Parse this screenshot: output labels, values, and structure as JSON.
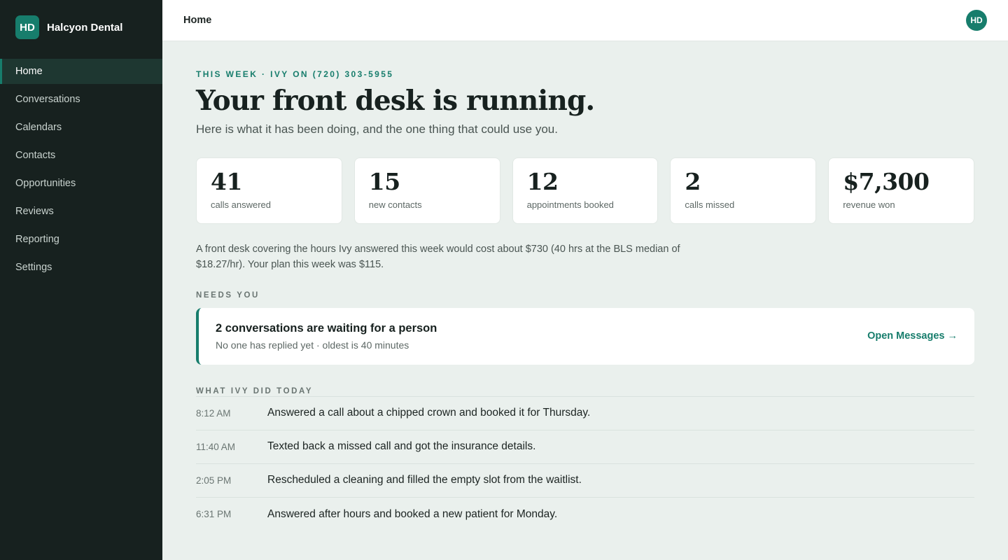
{
  "brand": {
    "initials": "HD",
    "name": "Halcyon Dental"
  },
  "nav": [
    {
      "label": "Home",
      "active": true
    },
    {
      "label": "Conversations"
    },
    {
      "label": "Calendars"
    },
    {
      "label": "Contacts"
    },
    {
      "label": "Opportunities"
    },
    {
      "label": "Reviews"
    },
    {
      "label": "Reporting"
    },
    {
      "label": "Settings"
    }
  ],
  "topbar": {
    "title": "Home",
    "avatar_initials": "HD"
  },
  "hero": {
    "eyebrow": "This week · Ivy on (720) 303-5955",
    "headline": "Your front desk is running.",
    "subline": "Here is what it has been doing, and the one thing that could use you."
  },
  "stats": [
    {
      "value": "41",
      "label": "calls answered"
    },
    {
      "value": "15",
      "label": "new contacts"
    },
    {
      "value": "12",
      "label": "appointments booked"
    },
    {
      "value": "2",
      "label": "calls missed"
    },
    {
      "value": "$7,300",
      "label": "revenue won"
    }
  ],
  "note": "A front desk covering the hours Ivy answered this week would cost about $730 (40 hrs at the BLS median of $18.27/hr). Your plan this week was $115.",
  "needs": {
    "label": "Needs you",
    "title": "2 conversations are waiting for a person",
    "subtitle": "No one has replied yet · oldest is 40 minutes",
    "action": "Open Messages →"
  },
  "activity": {
    "label": "What Ivy did today",
    "rows": [
      {
        "time": "8:12 AM",
        "text": "Answered a call about a chipped crown and booked it for Thursday."
      },
      {
        "time": "11:40 AM",
        "text": "Texted back a missed call and got the insurance details."
      },
      {
        "time": "2:05 PM",
        "text": "Rescheduled a cleaning and filled the empty slot from the waitlist."
      },
      {
        "time": "6:31 PM",
        "text": "Answered after hours and booked a new patient for Monday."
      }
    ]
  },
  "colors": {
    "accent": "#177d6c",
    "sidebar": "#17211f",
    "background": "#eaf0ed"
  }
}
